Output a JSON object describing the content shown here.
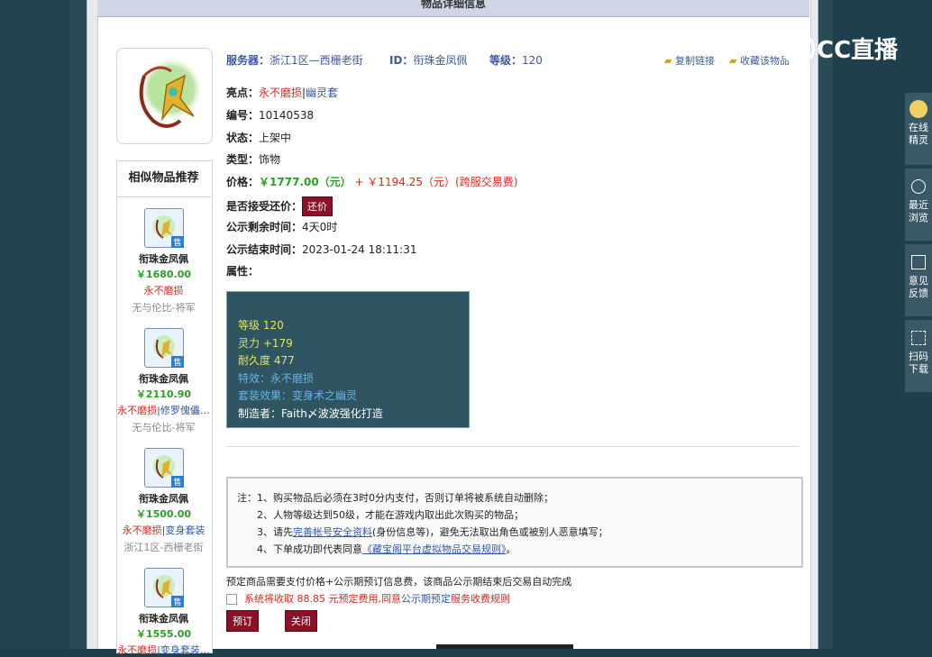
{
  "header": {
    "title": "物品详细信息"
  },
  "top": {
    "server_label": "服务器：",
    "server_value": "浙江1区—西栅老街",
    "id_label": "ID：",
    "id_value": "衔珠金凤佩",
    "level_label": "等级：",
    "level_value": "120",
    "copy_link": "复制链接",
    "collect": "收藏该物品"
  },
  "info": {
    "highlight_label": "亮点：",
    "highlight_a": "永不磨损",
    "highlight_sep": "|",
    "highlight_b": "幽灵套",
    "number_label": "编号：",
    "number_value": "10140538",
    "status_label": "状态：",
    "status_value": "上架中",
    "type_label": "类型：",
    "type_value": "饰物",
    "price_label": "价格：",
    "price_value": "￥1777.00（元）",
    "price_plus": "+",
    "price_fee": "￥1194.25（元）",
    "price_fee_note": "(跨服交易费)",
    "bargain_label": "是否接受还价：",
    "bargain_button": "还价",
    "remain_label": "公示剩余时间：",
    "remain_value": "4天0时",
    "end_label": "公示结束时间：",
    "end_value": "2023-01-24 18:11:31",
    "attr_label": "属性："
  },
  "attributes": [
    {
      "text": "等级 120",
      "color": "#e8e35a"
    },
    {
      "text": "灵力 +179",
      "color": "#e8e35a"
    },
    {
      "text": "耐久度 477",
      "color": "#e8e35a"
    },
    {
      "text": "特效：永不磨损",
      "color": "#66b3e8"
    },
    {
      "text": "套装效果：变身术之幽灵",
      "color": "#66b3e8"
    },
    {
      "text": "制造者：Faith〆波波强化打造",
      "color": "#ffffff"
    }
  ],
  "notice": {
    "line1": "注：1、购买物品后必须在3时0分内支付，否则订单将被系统自动删除；",
    "line2": "2、人物等级达到50级，才能在游戏内取出此次购买的物品；",
    "line3_pre": "3、请先",
    "line3_link": "完善帐号安全资料",
    "line3_post": "(身份信息等)，避免无法取出角色或被别人恶意填写；",
    "line4_pre": "4、下单成功即代表同意",
    "line4_link": "《藏宝阁平台虚拟物品交易规则》",
    "line4_post": "。"
  },
  "reserve": {
    "desc": "预定商品需要支付价格+公示期预订信息费，该商品公示期结束后交易自动完成",
    "fee_pre": "系统将收取 88.85 元预定费用,同意",
    "fee_link": "公示期预定",
    "fee_post": "服务收费规则",
    "reserve_button": "预订",
    "close_button": "关闭"
  },
  "similar": {
    "title": "相似物品推荐",
    "items": [
      {
        "name": "衔珠金凤佩",
        "price": "￥1680.00",
        "tag_a": "永不磨损",
        "tag_b": "",
        "server": "无与伦比-将军"
      },
      {
        "name": "衔珠金凤佩",
        "price": "￥2110.90",
        "tag_a": "永不磨损",
        "tag_b": "|修罗傀儡…",
        "server": "无与伦比-将军"
      },
      {
        "name": "衔珠金凤佩",
        "price": "￥1500.00",
        "tag_a": "永不磨损",
        "tag_b": "|变身套装",
        "server": "浙江1区-西栅老街"
      },
      {
        "name": "衔珠金凤佩",
        "price": "￥1555.00",
        "tag_a": "永不磨损",
        "tag_b": "|变身套装…",
        "server": ""
      }
    ],
    "icon_badge": "售"
  },
  "sidebar": {
    "items": [
      {
        "line1": "在线",
        "line2": "精灵"
      },
      {
        "line1": "最近",
        "line2": "浏览"
      },
      {
        "line1": "意见",
        "line2": "反馈"
      },
      {
        "line1": "扫码",
        "line2": "下载"
      }
    ]
  },
  "watermark": {
    "text": "CC直播"
  }
}
